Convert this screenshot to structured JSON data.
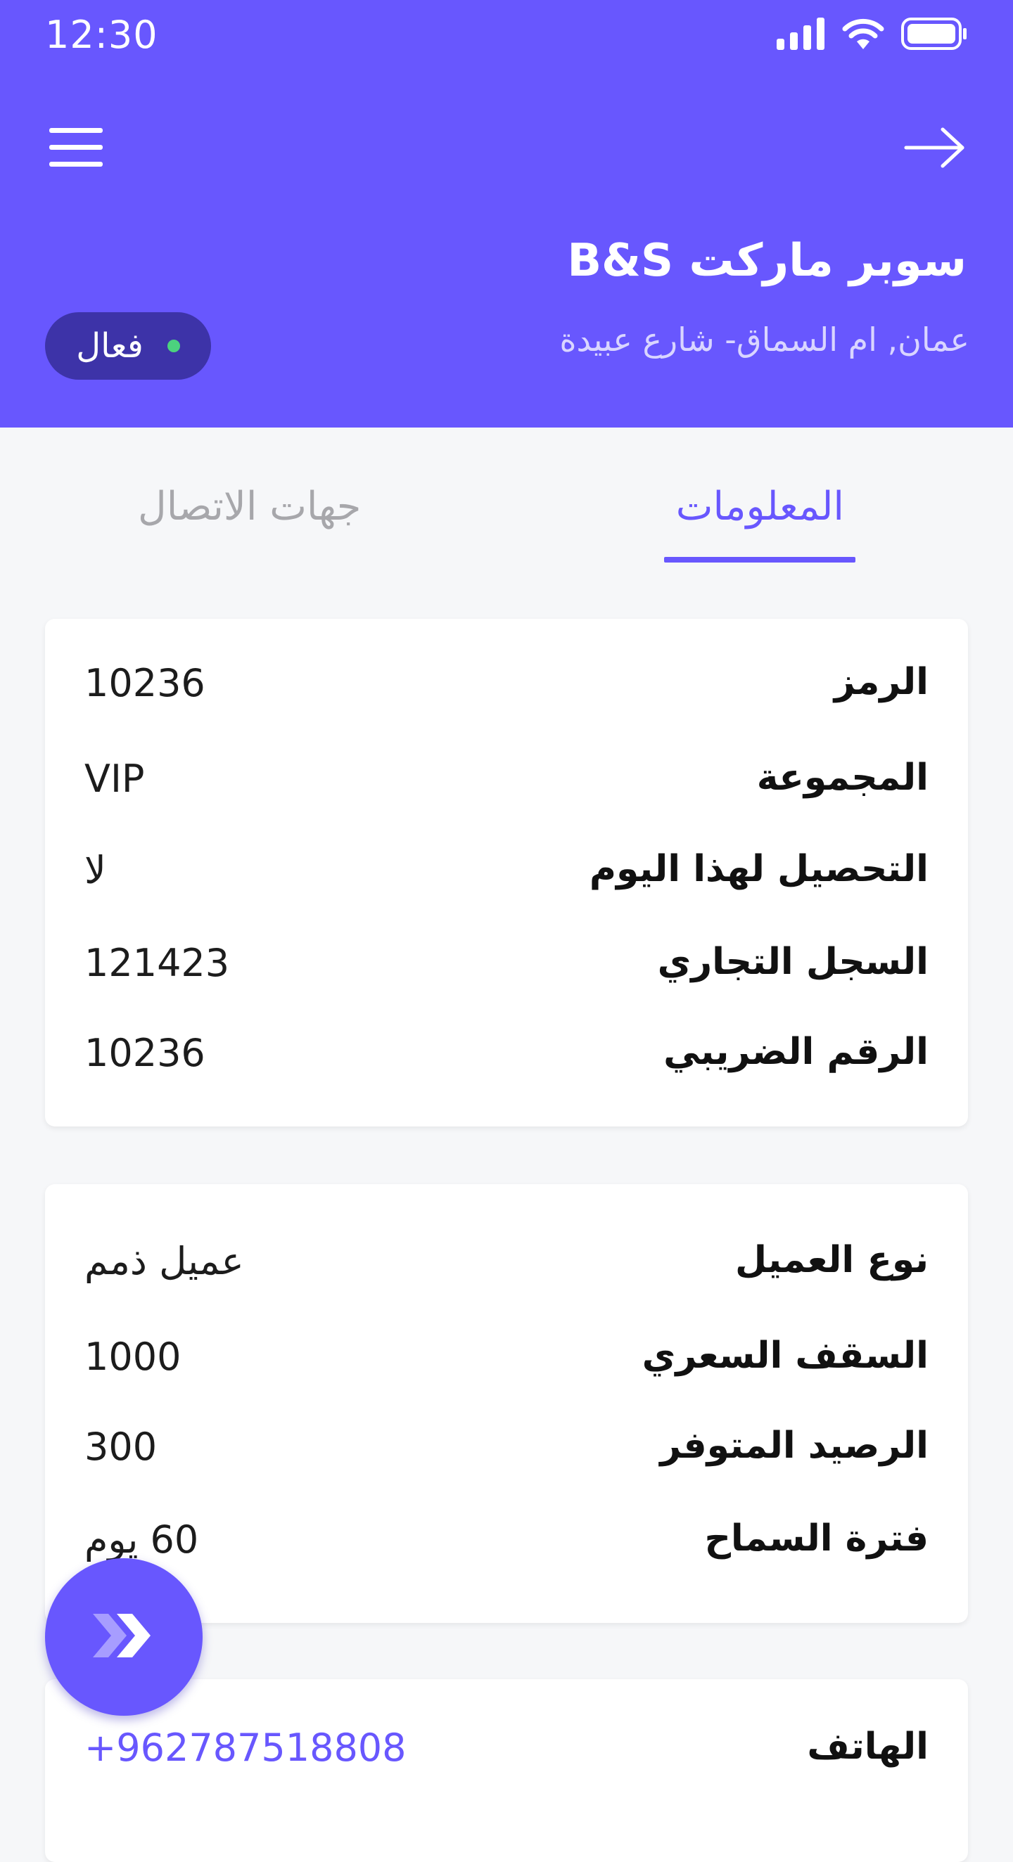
{
  "status_bar": {
    "time": "12:30",
    "icons": [
      "signal-icon",
      "wifi-icon",
      "battery-icon"
    ]
  },
  "header": {
    "title": "سوبر ماركت B&S",
    "address": "عمان, ام السماق- شارع عبيدة",
    "status_label": "فعال",
    "status_color": "#4cd27e",
    "icons": [
      "menu-icon",
      "arrow-right-icon"
    ]
  },
  "tabs": [
    {
      "label": "المعلومات",
      "active": true
    },
    {
      "label": "جهات الاتصال",
      "active": false
    }
  ],
  "card1": {
    "rows": [
      {
        "label": "الرمز",
        "value": "10236"
      },
      {
        "label": "المجموعة",
        "value": "VIP"
      },
      {
        "label": "التحصيل لهذا اليوم",
        "value": "لا"
      },
      {
        "label": "السجل التجاري",
        "value": "121423"
      },
      {
        "label": "الرقم الضريبي",
        "value": "10236"
      }
    ]
  },
  "card2": {
    "rows": [
      {
        "label": "نوع العميل",
        "value": "عميل ذمم"
      },
      {
        "label": "السقف السعري",
        "value": "1000"
      },
      {
        "label": "الرصيد المتوفر",
        "value": "300"
      },
      {
        "label": "فترة السماح",
        "value": "60 يوم"
      }
    ]
  },
  "card3": {
    "rows": [
      {
        "label": "الهاتف",
        "value": "+962787518808"
      }
    ]
  },
  "fab": {
    "icon": "double-chevron-icon"
  },
  "colors": {
    "primary": "#6857fe",
    "pill": "#3d33a8",
    "background": "#f6f7f9"
  }
}
